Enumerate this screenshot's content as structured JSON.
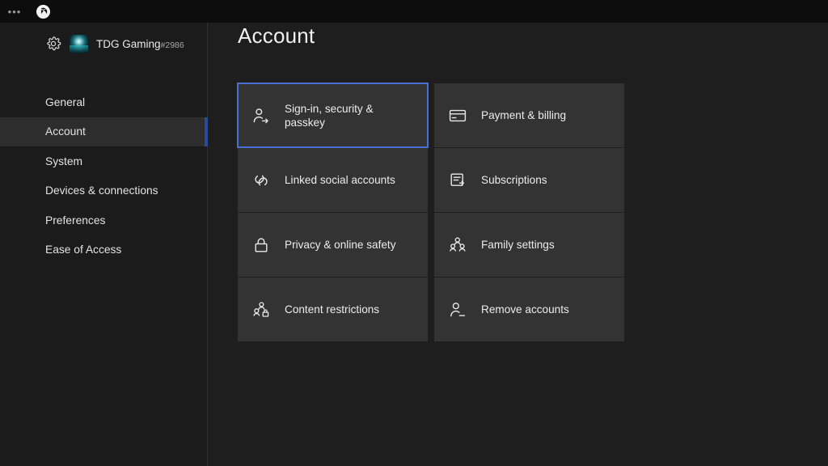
{
  "topbar": {
    "ellipsis": "•••",
    "ellipsis_icon": "more-options-icon",
    "xbox_icon": "xbox-logo-icon"
  },
  "sidebar": {
    "gear_icon": "gear-icon",
    "avatar_icon": "user-avatar",
    "gamertag": "TDG Gaming",
    "gamertag_suffix": "#2986",
    "items": [
      {
        "label": "General",
        "selected": false
      },
      {
        "label": "Account",
        "selected": true
      },
      {
        "label": "System",
        "selected": false
      },
      {
        "label": "Devices & connections",
        "selected": false
      },
      {
        "label": "Preferences",
        "selected": false
      },
      {
        "label": "Ease of Access",
        "selected": false
      }
    ]
  },
  "main": {
    "title": "Account",
    "tiles": [
      {
        "label": "Sign-in, security & passkey",
        "icon": "person-arrow-icon",
        "focused": true
      },
      {
        "label": "Payment & billing",
        "icon": "credit-card-icon",
        "focused": false
      },
      {
        "label": "Linked social accounts",
        "icon": "link-icon",
        "focused": false
      },
      {
        "label": "Subscriptions",
        "icon": "document-list-icon",
        "focused": false
      },
      {
        "label": "Privacy & online safety",
        "icon": "lock-icon",
        "focused": false
      },
      {
        "label": "Family settings",
        "icon": "people-group-icon",
        "focused": false
      },
      {
        "label": "Content restrictions",
        "icon": "people-lock-icon",
        "focused": false
      },
      {
        "label": "Remove accounts",
        "icon": "person-minus-icon",
        "focused": false
      }
    ]
  },
  "colors": {
    "background": "#1b1b1b",
    "content_background": "#1e1e1e",
    "tile": "#333333",
    "focus_border": "#4a6fd4",
    "nav_selected": "#2d2d2d",
    "nav_accent": "#2a4a9e",
    "text": "#ececec"
  }
}
